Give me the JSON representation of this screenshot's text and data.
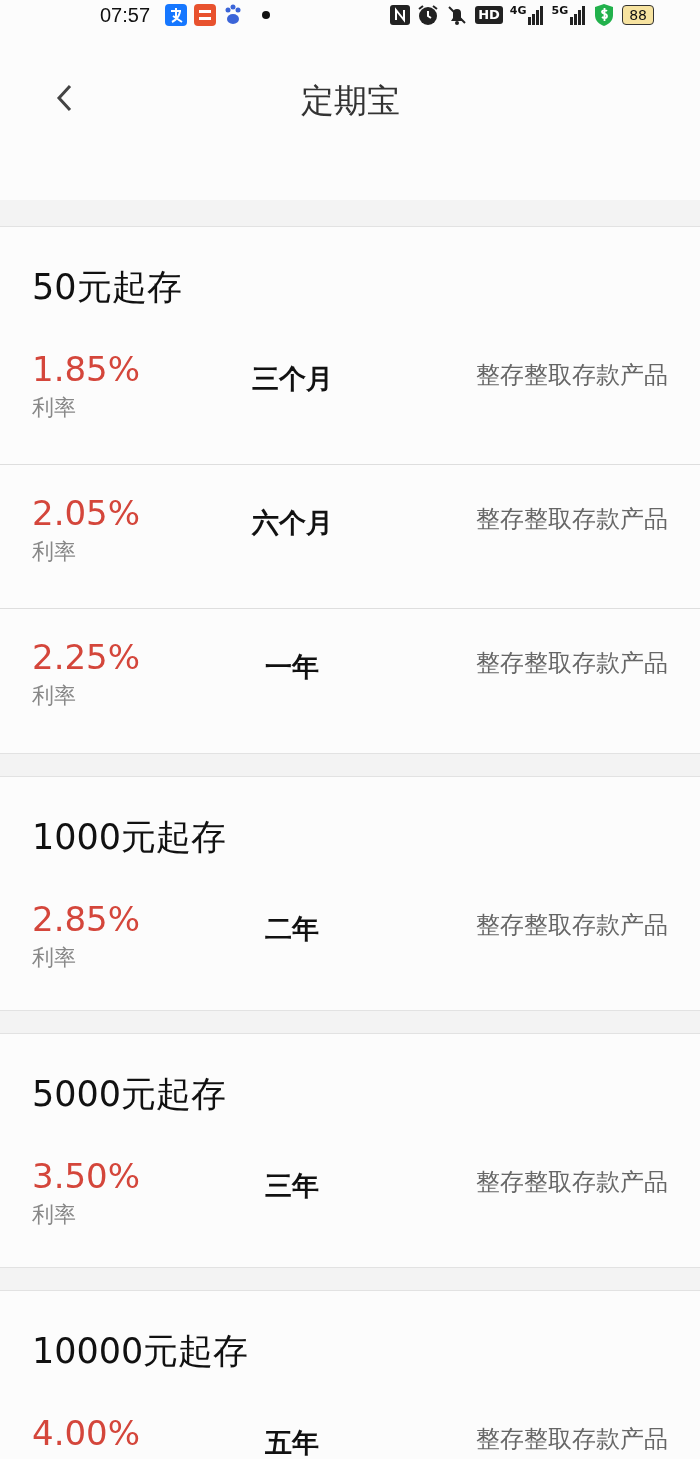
{
  "status_bar": {
    "time": "07:57",
    "hd": "HD",
    "network_1": "4G",
    "network_2": "5G",
    "battery": "88"
  },
  "header": {
    "title": "定期宝"
  },
  "groups": [
    {
      "title": "50元起存",
      "products": [
        {
          "rate": "1.85%",
          "rate_label": "利率",
          "term": "三个月",
          "type": "整存整取存款产品"
        },
        {
          "rate": "2.05%",
          "rate_label": "利率",
          "term": "六个月",
          "type": "整存整取存款产品"
        },
        {
          "rate": "2.25%",
          "rate_label": "利率",
          "term": "一年",
          "type": "整存整取存款产品"
        }
      ]
    },
    {
      "title": "1000元起存",
      "products": [
        {
          "rate": "2.85%",
          "rate_label": "利率",
          "term": "二年",
          "type": "整存整取存款产品"
        }
      ]
    },
    {
      "title": "5000元起存",
      "products": [
        {
          "rate": "3.50%",
          "rate_label": "利率",
          "term": "三年",
          "type": "整存整取存款产品"
        }
      ]
    },
    {
      "title": "10000元起存",
      "products": [
        {
          "rate": "4.00%",
          "term": "五年",
          "type": "整存整取存款产品"
        }
      ]
    }
  ]
}
